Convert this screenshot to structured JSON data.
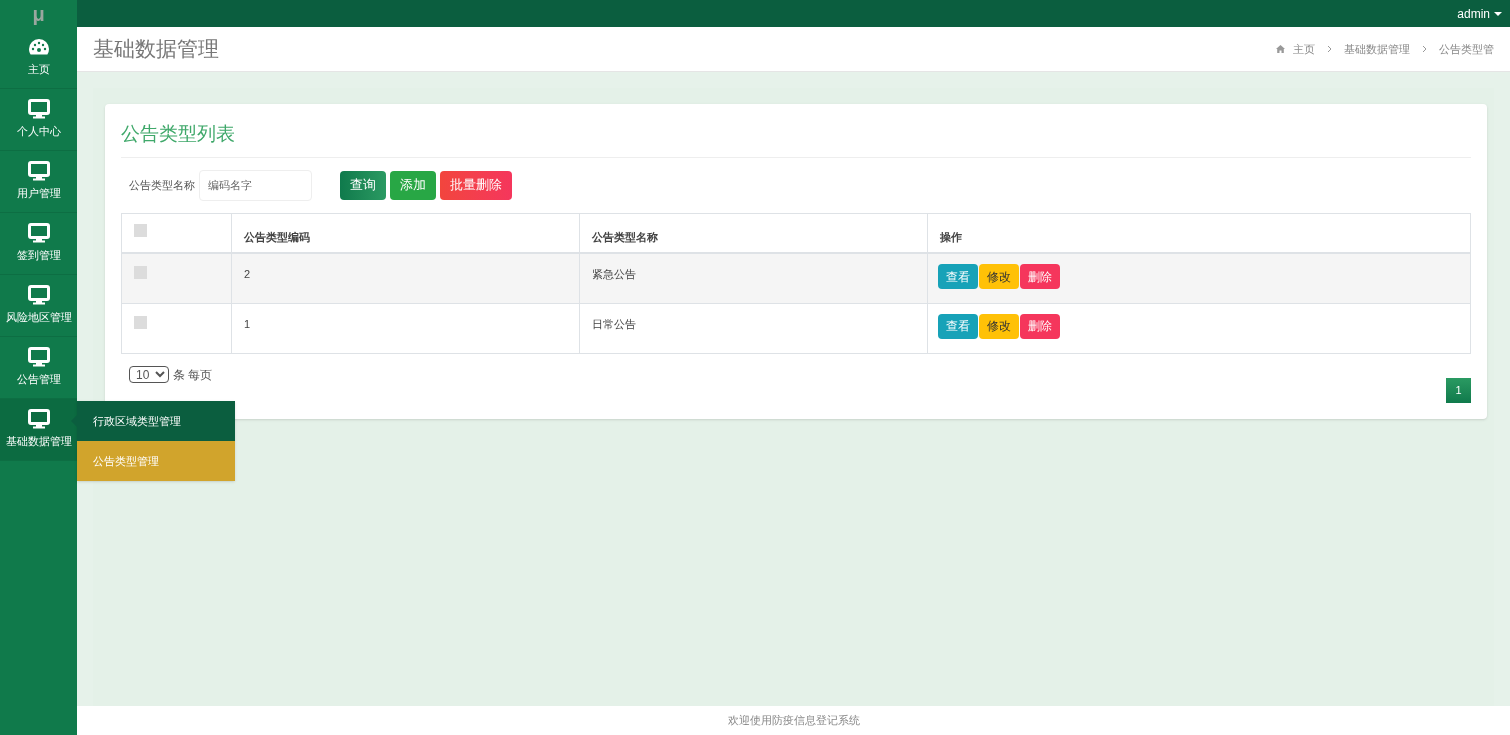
{
  "topbar": {
    "logo": "μ",
    "user": "admin"
  },
  "sidebar": {
    "items": [
      {
        "label": "主页",
        "selected": false
      },
      {
        "label": "个人中心",
        "selected": false
      },
      {
        "label": "用户管理",
        "selected": false
      },
      {
        "label": "签到管理",
        "selected": false
      },
      {
        "label": "风险地区管理",
        "selected": false
      },
      {
        "label": "公告管理",
        "selected": false
      },
      {
        "label": "基础数据管理",
        "selected": true,
        "submenu": [
          {
            "label": "行政区域类型管理",
            "selected": false
          },
          {
            "label": "公告类型管理",
            "selected": true
          }
        ]
      }
    ]
  },
  "header": {
    "title": "基础数据管理",
    "breadcrumb": [
      "主页",
      "基础数据管理",
      "公告类型管"
    ]
  },
  "card": {
    "title": "公告类型列表",
    "search": {
      "label": "公告类型名称",
      "placeholder": "编码名字"
    },
    "buttons": [
      {
        "label": "查询",
        "kind": "query"
      },
      {
        "label": "添加",
        "kind": "add"
      },
      {
        "label": "批量删除",
        "kind": "delete"
      }
    ],
    "table": {
      "columns": [
        "公告类型编码",
        "公告类型名称",
        "操作"
      ],
      "header_checked": false,
      "rows": [
        {
          "checked": false,
          "code": "2",
          "name": "紧急公告",
          "actions": [
            {
              "label": "查看",
              "kind": "view"
            },
            {
              "label": "修改",
              "kind": "edit"
            },
            {
              "label": "删除",
              "kind": "delete"
            }
          ]
        },
        {
          "checked": false,
          "code": "1",
          "name": "日常公告",
          "actions": [
            {
              "label": "查看",
              "kind": "view"
            },
            {
              "label": "修改",
              "kind": "edit"
            },
            {
              "label": "删除",
              "kind": "delete"
            }
          ]
        }
      ]
    },
    "page_size": {
      "value": "10",
      "suffix": "条 每页"
    },
    "pages": [
      {
        "label": "1",
        "selected": true
      }
    ]
  },
  "footer": "欢迎使用防疫信息登记系统"
}
